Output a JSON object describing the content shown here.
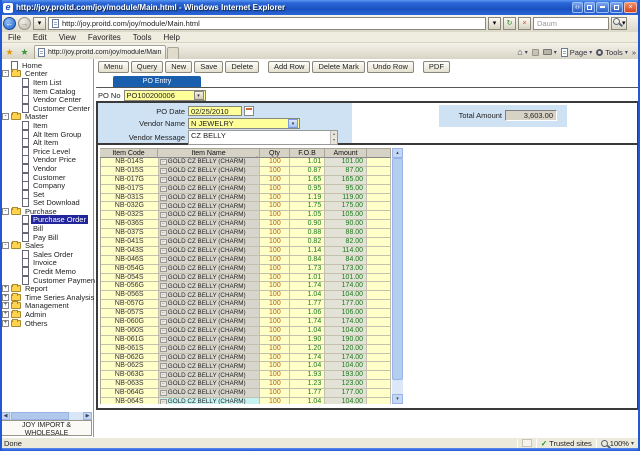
{
  "browser": {
    "title": "http://joy.proitd.com/joy/module/Main.html - Windows Internet Explorer",
    "url": "http://joy.proitd.com/joy/module/Main.html",
    "back_glyph": "←",
    "forward_glyph": "→",
    "menu": [
      "File",
      "Edit",
      "View",
      "Favorites",
      "Tools",
      "Help"
    ],
    "tab_title": "http://joy.proitd.com/joy/module/Main.html",
    "search_placeholder": "Daum",
    "command_bar": {
      "page_label": "Page",
      "tools_label": "Tools",
      "overflow": "»"
    },
    "status": {
      "left": "Done",
      "trusted_check": "✓",
      "trusted": "Trusted sites",
      "zoom": "100%"
    }
  },
  "sidebar": {
    "tree": [
      {
        "label": "Home",
        "depth": 0,
        "icon": "doc"
      },
      {
        "label": "Center",
        "depth": 0,
        "icon": "folder",
        "expander": "-"
      },
      {
        "label": "Item List",
        "depth": 1,
        "icon": "doc"
      },
      {
        "label": "Item Catalog",
        "depth": 1,
        "icon": "doc"
      },
      {
        "label": "Vendor Center",
        "depth": 1,
        "icon": "doc"
      },
      {
        "label": "Customer Center",
        "depth": 1,
        "icon": "doc"
      },
      {
        "label": "Master",
        "depth": 0,
        "icon": "folder",
        "expander": "-"
      },
      {
        "label": "Item",
        "depth": 1,
        "icon": "doc"
      },
      {
        "label": "Alt Item Group",
        "depth": 1,
        "icon": "doc"
      },
      {
        "label": "Alt Item",
        "depth": 1,
        "icon": "doc"
      },
      {
        "label": "Price Level",
        "depth": 1,
        "icon": "doc"
      },
      {
        "label": "Vendor Price",
        "depth": 1,
        "icon": "doc"
      },
      {
        "label": "Vendor",
        "depth": 1,
        "icon": "doc"
      },
      {
        "label": "Customer",
        "depth": 1,
        "icon": "doc"
      },
      {
        "label": "Company",
        "depth": 1,
        "icon": "doc"
      },
      {
        "label": "Set",
        "depth": 1,
        "icon": "doc"
      },
      {
        "label": "Set Download",
        "depth": 1,
        "icon": "doc"
      },
      {
        "label": "Purchase",
        "depth": 0,
        "icon": "folder",
        "expander": "-"
      },
      {
        "label": "Purchase Order",
        "depth": 1,
        "icon": "doc",
        "selected": true
      },
      {
        "label": "Bill",
        "depth": 1,
        "icon": "doc"
      },
      {
        "label": "Pay Bill",
        "depth": 1,
        "icon": "doc"
      },
      {
        "label": "Sales",
        "depth": 0,
        "icon": "folder",
        "expander": "-"
      },
      {
        "label": "Sales Order",
        "depth": 1,
        "icon": "doc"
      },
      {
        "label": "Invoice",
        "depth": 1,
        "icon": "doc"
      },
      {
        "label": "Credit Memo",
        "depth": 1,
        "icon": "doc"
      },
      {
        "label": "Customer Payment",
        "depth": 1,
        "icon": "doc"
      },
      {
        "label": "Report",
        "depth": 0,
        "icon": "folder",
        "expander": "+"
      },
      {
        "label": "Time Series Analysis",
        "depth": 0,
        "icon": "folder",
        "expander": "+"
      },
      {
        "label": "Management",
        "depth": 0,
        "icon": "folder",
        "expander": "+"
      },
      {
        "label": "Admin",
        "depth": 0,
        "icon": "folder",
        "expander": "+"
      },
      {
        "label": "Others",
        "depth": 0,
        "icon": "folder",
        "expander": "+"
      }
    ],
    "footer_line1": "JOY IMPORT &",
    "footer_line2": "WHOLESALE"
  },
  "toolbar": {
    "groups": [
      [
        "Menu",
        "Query",
        "New",
        "Save",
        "Delete"
      ],
      [
        "Add Row",
        "Delete Mark",
        "Undo Row"
      ],
      [
        "PDF"
      ]
    ]
  },
  "po": {
    "tab_label": "PO Entry",
    "po_no_label": "PO No",
    "po_no_value": "PO100200006",
    "po_date_label": "PO Date",
    "po_date_value": "02/25/2010",
    "vendor_name_label": "Vendor Name",
    "vendor_name_value": "N JEWELRY",
    "vendor_message_label": "Vendor Message",
    "vendor_message_value": "CZ BELLY",
    "total_amount_label": "Total Amount",
    "total_amount_value": "3,603.00"
  },
  "table": {
    "headers": [
      "Item Code",
      "Item Name",
      "Qty",
      "F.O.B",
      "Amount",
      ""
    ],
    "rows": [
      {
        "code": "NB-014S",
        "name": "GOLD CZ BELLY (CHARM)",
        "qty": "100",
        "fob": "1.01",
        "amount": "101.00"
      },
      {
        "code": "NB-015S",
        "name": "GOLD CZ BELLY (CHARM)",
        "qty": "100",
        "fob": "0.87",
        "amount": "87.00"
      },
      {
        "code": "NB-017G",
        "name": "GOLD CZ BELLY (CHARM)",
        "qty": "100",
        "fob": "1.65",
        "amount": "165.00"
      },
      {
        "code": "NB-017S",
        "name": "GOLD CZ BELLY (CHARM)",
        "qty": "100",
        "fob": "0.95",
        "amount": "95.00"
      },
      {
        "code": "NB-031S",
        "name": "GOLD CZ BELLY (CHARM)",
        "qty": "100",
        "fob": "1.19",
        "amount": "119.00"
      },
      {
        "code": "NB-032G",
        "name": "GOLD CZ BELLY (CHARM)",
        "qty": "100",
        "fob": "1.75",
        "amount": "175.00"
      },
      {
        "code": "NB-032S",
        "name": "GOLD CZ BELLY (CHARM)",
        "qty": "100",
        "fob": "1.05",
        "amount": "105.00"
      },
      {
        "code": "NB-036S",
        "name": "GOLD CZ BELLY (CHARM)",
        "qty": "100",
        "fob": "0.90",
        "amount": "90.00"
      },
      {
        "code": "NB-037S",
        "name": "GOLD CZ BELLY (CHARM)",
        "qty": "100",
        "fob": "0.88",
        "amount": "88.00"
      },
      {
        "code": "NB-041S",
        "name": "GOLD CZ BELLY (CHARM)",
        "qty": "100",
        "fob": "0.82",
        "amount": "82.00"
      },
      {
        "code": "NB-043S",
        "name": "GOLD CZ BELLY (CHARM)",
        "qty": "100",
        "fob": "1.14",
        "amount": "114.00"
      },
      {
        "code": "NB-046S",
        "name": "GOLD CZ BELLY (CHARM)",
        "qty": "100",
        "fob": "0.84",
        "amount": "84.00"
      },
      {
        "code": "NB-054G",
        "name": "GOLD CZ BELLY (CHARM)",
        "qty": "100",
        "fob": "1.73",
        "amount": "173.00"
      },
      {
        "code": "NB-054S",
        "name": "GOLD CZ BELLY (CHARM)",
        "qty": "100",
        "fob": "1.01",
        "amount": "101.00"
      },
      {
        "code": "NB-056G",
        "name": "GOLD CZ BELLY (CHARM)",
        "qty": "100",
        "fob": "1.74",
        "amount": "174.00"
      },
      {
        "code": "NB-056S",
        "name": "GOLD CZ BELLY (CHARM)",
        "qty": "100",
        "fob": "1.04",
        "amount": "104.00"
      },
      {
        "code": "NB-057G",
        "name": "GOLD CZ BELLY (CHARM)",
        "qty": "100",
        "fob": "1.77",
        "amount": "177.00"
      },
      {
        "code": "NB-057S",
        "name": "GOLD CZ BELLY (CHARM)",
        "qty": "100",
        "fob": "1.06",
        "amount": "106.00"
      },
      {
        "code": "NB-060G",
        "name": "GOLD CZ BELLY (CHARM)",
        "qty": "100",
        "fob": "1.74",
        "amount": "174.00"
      },
      {
        "code": "NB-060S",
        "name": "GOLD CZ BELLY (CHARM)",
        "qty": "100",
        "fob": "1.04",
        "amount": "104.00"
      },
      {
        "code": "NB-061G",
        "name": "GOLD CZ BELLY (CHARM)",
        "qty": "100",
        "fob": "1.90",
        "amount": "190.00"
      },
      {
        "code": "NB-061S",
        "name": "GOLD CZ BELLY (CHARM)",
        "qty": "100",
        "fob": "1.20",
        "amount": "120.00"
      },
      {
        "code": "NB-062G",
        "name": "GOLD CZ BELLY (CHARM)",
        "qty": "100",
        "fob": "1.74",
        "amount": "174.00"
      },
      {
        "code": "NB-062S",
        "name": "GOLD CZ BELLY (CHARM)",
        "qty": "100",
        "fob": "1.04",
        "amount": "104.00"
      },
      {
        "code": "NB-063G",
        "name": "GOLD CZ BELLY (CHARM)",
        "qty": "100",
        "fob": "1.93",
        "amount": "193.00"
      },
      {
        "code": "NB-063S",
        "name": "GOLD CZ BELLY (CHARM)",
        "qty": "100",
        "fob": "1.23",
        "amount": "123.00"
      },
      {
        "code": "NB-064G",
        "name": "GOLD CZ BELLY (CHARM)",
        "qty": "100",
        "fob": "1.77",
        "amount": "177.00"
      },
      {
        "code": "NB-064S",
        "name": "GOLD CZ BELLY (CHARM)",
        "qty": "100",
        "fob": "1.04",
        "amount": "104.00",
        "highlighted": true
      }
    ]
  }
}
